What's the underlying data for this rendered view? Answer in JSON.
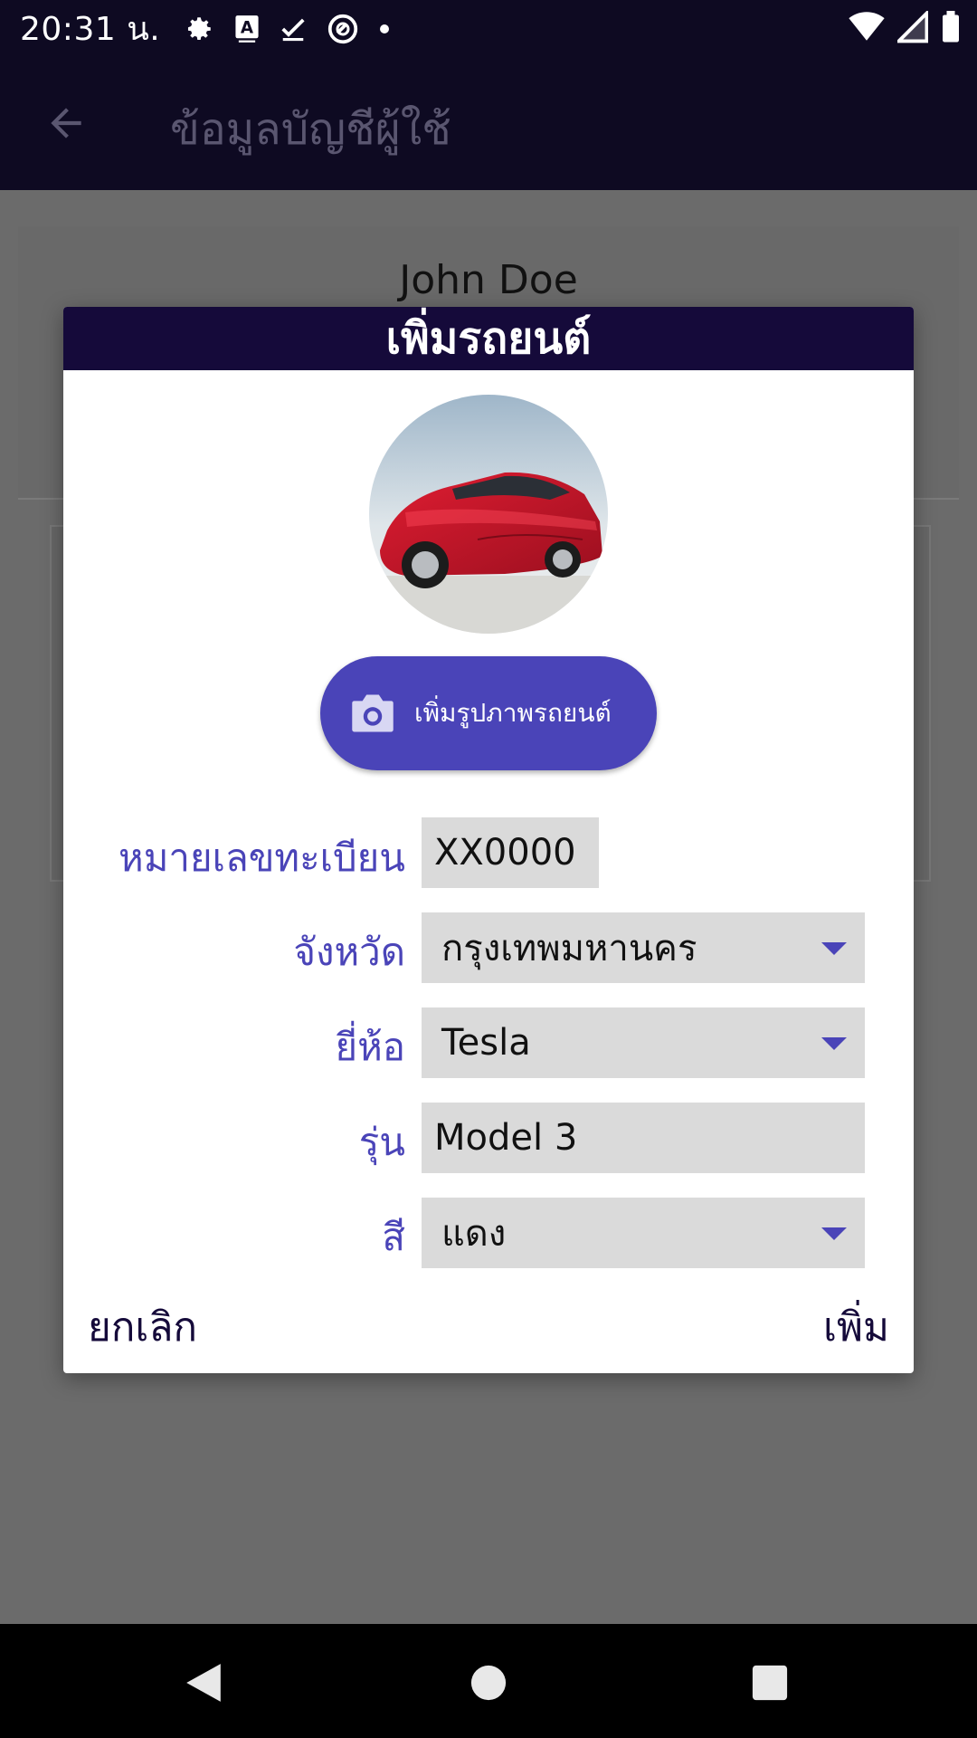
{
  "status_bar": {
    "time": "20:31 น.",
    "icons": [
      "settings-icon",
      "a-box-icon",
      "checkmark-icon",
      "circle-logo-icon",
      "dot-icon"
    ],
    "right_icons": [
      "wifi-icon",
      "signal-icon",
      "battery-icon"
    ]
  },
  "app_bar": {
    "back_icon": "arrow-left-icon",
    "title": "ข้อมูลบัญชีผู้ใช้"
  },
  "background": {
    "user_name": "John Doe"
  },
  "dialog": {
    "title": "เพิ่มรถยนต์",
    "add_photo_label": "เพิ่มรูปภาพรถยนต์",
    "fields": {
      "plate_label": "หมายเลขทะเบียน",
      "plate_value": "XX0000",
      "province_label": "จังหวัด",
      "province_value": "กรุงเทพมหานคร",
      "brand_label": "ยี่ห้อ",
      "brand_value": "Tesla",
      "model_label": "รุ่น",
      "model_value": "Model 3",
      "color_label": "สี",
      "color_value": "แดง"
    },
    "cancel_label": "ยกเลิก",
    "add_label": "เพิ่ม"
  },
  "colors": {
    "primary_dark": "#150a3a",
    "accent": "#4a44b8",
    "field_bg": "#dadada",
    "scrim": "#6b6b6b"
  }
}
